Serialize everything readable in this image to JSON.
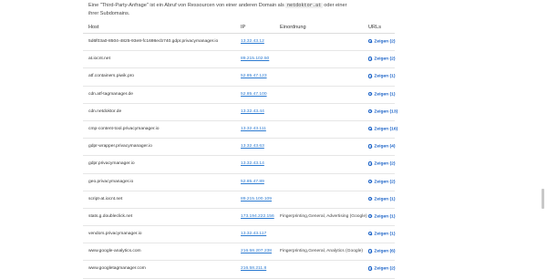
{
  "intro": {
    "line1_pre": "Eine \"Third-Party-Anfrage\" ist ein Abruf von Ressourcen von einer anderen Domain als",
    "domain_code": "netdoktor.at",
    "line1_post": "oder einer",
    "line2": "ihrer Subdomains."
  },
  "table": {
    "headers": {
      "host": "Host",
      "ip": "IP",
      "einordnung": "Einordnung",
      "urls": "URLs"
    },
    "rows": [
      {
        "host": "5d6f03a0-8504-4825-93e8-fc1698ecb740.gdpr.privacymanager.io",
        "ip": "13.32.43.12",
        "einordnung": "",
        "urls": "Zeigen (2)"
      },
      {
        "host": "at.iocnt.net",
        "ip": "89.215.102.50",
        "einordnung": "",
        "urls": "Zeigen (2)"
      },
      {
        "host": "atf.containers.piwik.pro",
        "ip": "52.85.47.123",
        "einordnung": "",
        "urls": "Zeigen (1)"
      },
      {
        "host": "cdn.atf-tagmanager.de",
        "ip": "52.85.47.100",
        "einordnung": "",
        "urls": "Zeigen (1)"
      },
      {
        "host": "cdn.netdoktor.de",
        "ip": "13.32.43.44",
        "einordnung": "",
        "urls": "Zeigen (13)"
      },
      {
        "host": "cmp-content-tool.privacymanager.io",
        "ip": "13.32.43.111",
        "einordnung": "",
        "urls": "Zeigen (16)"
      },
      {
        "host": "gdpr-wrapper.privacymanager.io",
        "ip": "13.32.43.63",
        "einordnung": "",
        "urls": "Zeigen (4)"
      },
      {
        "host": "gdpr.privacymanager.io",
        "ip": "13.32.43.14",
        "einordnung": "",
        "urls": "Zeigen (2)"
      },
      {
        "host": "geo.privacymanager.io",
        "ip": "52.85.47.89",
        "einordnung": "",
        "urls": "Zeigen (2)"
      },
      {
        "host": "script-at.iocnt.net",
        "ip": "89.215.100.109",
        "einordnung": "",
        "urls": "Zeigen (1)"
      },
      {
        "host": "stats.g.doubleclick.net",
        "ip": "173.194.222.156",
        "einordnung": "Fingerprinting,General, Advertising (Google)",
        "urls": "Zeigen (1)"
      },
      {
        "host": "vendors.privacymanager.io",
        "ip": "13.32.43.117",
        "einordnung": "",
        "urls": "Zeigen (1)"
      },
      {
        "host": "www.google-analytics.com",
        "ip": "216.58.207.238",
        "einordnung": "Fingerprinting,General, Analytics (Google)",
        "urls": "Zeigen (6)"
      },
      {
        "host": "www.googletagmanager.com",
        "ip": "216.58.211.8",
        "einordnung": "",
        "urls": "Zeigen (2)"
      }
    ]
  },
  "icons": {
    "url_icon": "arrow-circle-icon"
  },
  "colors": {
    "link": "#2b7ad1",
    "url_link": "#1a62c7"
  }
}
